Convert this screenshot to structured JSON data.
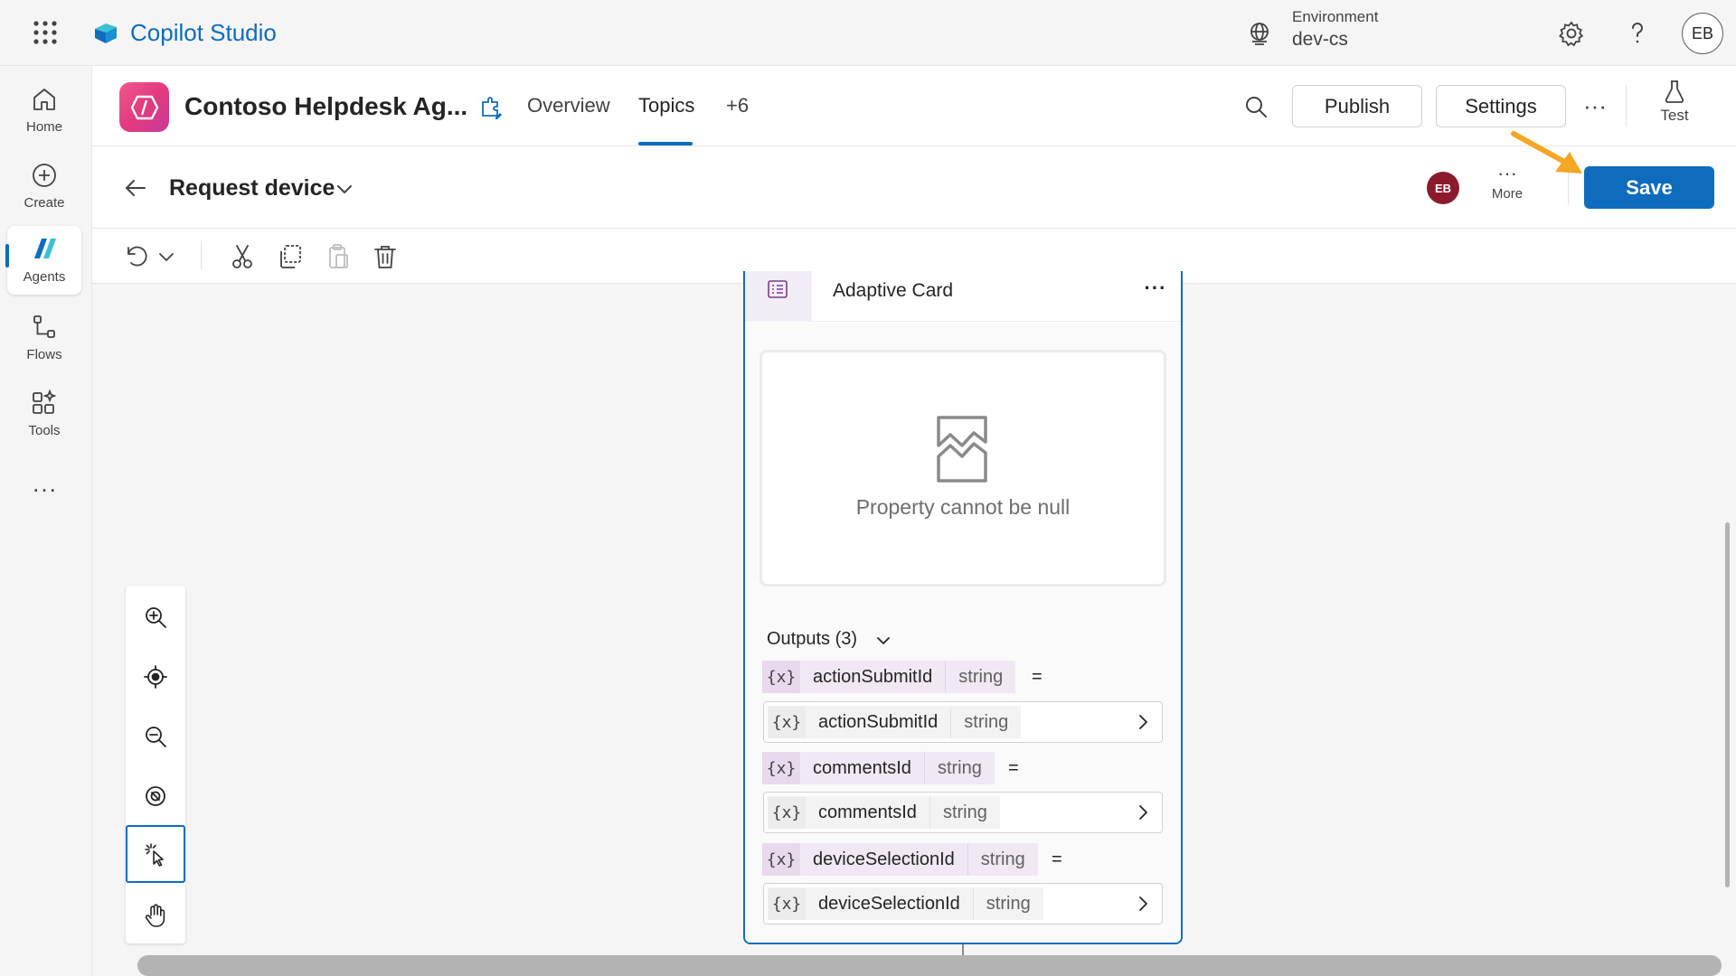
{
  "app": {
    "name": "Copilot Studio",
    "environment_label": "Environment",
    "environment_value": "dev-cs",
    "user_initials": "EB",
    "icons": {
      "waffle": "waffle-icon",
      "environment": "globe-icon",
      "settings": "gear-icon",
      "help": "help-icon"
    }
  },
  "left_rail": {
    "items": [
      {
        "label": "Home",
        "icon": "home-icon"
      },
      {
        "label": "Create",
        "icon": "plus-circle-icon"
      },
      {
        "label": "Agents",
        "icon": "agents-icon",
        "active": true
      },
      {
        "label": "Flows",
        "icon": "flows-icon"
      },
      {
        "label": "Tools",
        "icon": "tools-icon"
      }
    ],
    "more_label": "..."
  },
  "agent_header": {
    "name": "Contoso Helpdesk Ag...",
    "tabs": [
      {
        "label": "Overview"
      },
      {
        "label": "Topics",
        "active": true
      },
      {
        "label": "+6"
      }
    ],
    "publish_label": "Publish",
    "settings_label": "Settings",
    "more_label": "···",
    "test_label": "Test"
  },
  "topic_header": {
    "name": "Request device",
    "user_badge": "EB",
    "more_label": "More",
    "more_dots": "···",
    "save_label": "Save",
    "save_color": "#0f6cbd"
  },
  "toolbar": {
    "icons": [
      "undo-icon",
      "chevron-down-icon",
      "cut-icon",
      "copy-icon",
      "paste-icon",
      "delete-icon"
    ]
  },
  "zoom_controls": {
    "icons": [
      "zoom-in-icon",
      "recenter-icon",
      "zoom-out-icon",
      "minimap-off-icon",
      "select-pointer-icon",
      "pan-hand-icon"
    ],
    "selected": "select-pointer-icon"
  },
  "node": {
    "title": "Adaptive Card",
    "menu_label": "···",
    "preview_error": "Property cannot be null",
    "outputs_title": "Outputs (3)",
    "outputs": [
      {
        "name": "actionSubmitId",
        "type": "string",
        "var_symbol": "{x}",
        "assigned_name": "actionSubmitId",
        "assigned_type": "string"
      },
      {
        "name": "commentsId",
        "type": "string",
        "var_symbol": "{x}",
        "assigned_name": "commentsId",
        "assigned_type": "string"
      },
      {
        "name": "deviceSelectionId",
        "type": "string",
        "var_symbol": "{x}",
        "assigned_name": "deviceSelectionId",
        "assigned_type": "string"
      }
    ],
    "equals": "="
  },
  "annotation": {
    "arrow_color": "#f5a623"
  }
}
